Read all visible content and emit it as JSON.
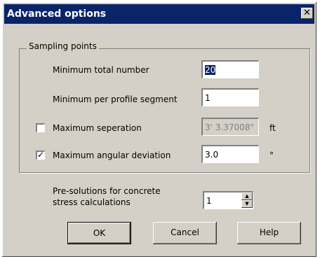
{
  "window": {
    "title": "Advanced options",
    "close_label": "✕"
  },
  "sampling": {
    "group_title": "Sampling points",
    "min_total_label": "Minimum total number",
    "min_total_value": "20",
    "min_per_segment_label": "Minimum per profile segment",
    "min_per_segment_value": "1",
    "max_separation": {
      "checked": false,
      "label": "Maximum seperation",
      "value": "3' 3.37008\"",
      "unit": "ft"
    },
    "max_angular": {
      "checked": true,
      "label": "Maximum angular deviation",
      "value": "3.0",
      "unit": "°"
    }
  },
  "presolutions": {
    "label_line1": "Pre-solutions for concrete",
    "label_line2": "stress calculations",
    "value": "1"
  },
  "buttons": {
    "ok": "OK",
    "cancel": "Cancel",
    "help": "Help"
  }
}
